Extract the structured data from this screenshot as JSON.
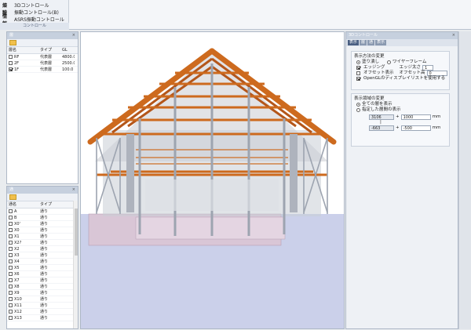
{
  "ribbon": {
    "rows": [
      {
        "icon": "燦",
        "label": "3Dコントロール"
      },
      {
        "icon": "驗",
        "label": "振動コントロール(B)"
      },
      {
        "icon": "情報",
        "label": "ASRS振動コントロール"
      }
    ],
    "group_label": "コントロール"
  },
  "layer_panel": {
    "title": "層",
    "columns": [
      "層名",
      "タイプ",
      "GL"
    ],
    "rows": [
      {
        "name": "RF",
        "type": "代表層",
        "gl": "4800.0",
        "checked": false
      },
      {
        "name": "2F",
        "type": "代表層",
        "gl": "2500.0",
        "checked": false
      },
      {
        "name": "1F",
        "type": "代表層",
        "gl": "100.0",
        "checked": true
      }
    ]
  },
  "grid_panel": {
    "title": "通",
    "columns": [
      "通名",
      "タイプ"
    ],
    "rows": [
      {
        "name": "A",
        "type": "通り"
      },
      {
        "name": "B",
        "type": "通り"
      },
      {
        "name": "X0'",
        "type": "通り"
      },
      {
        "name": "X0",
        "type": "通り"
      },
      {
        "name": "X1",
        "type": "通り"
      },
      {
        "name": "X2?",
        "type": "通り"
      },
      {
        "name": "X2",
        "type": "通り"
      },
      {
        "name": "X3",
        "type": "通り"
      },
      {
        "name": "X4",
        "type": "通り"
      },
      {
        "name": "X5",
        "type": "通り"
      },
      {
        "name": "X6",
        "type": "通り"
      },
      {
        "name": "X7",
        "type": "通り"
      },
      {
        "name": "X8",
        "type": "通り"
      },
      {
        "name": "X9",
        "type": "通り"
      },
      {
        "name": "X10",
        "type": "通り"
      },
      {
        "name": "X11",
        "type": "通り"
      },
      {
        "name": "X12",
        "type": "通り"
      },
      {
        "name": "X13",
        "type": "通り"
      }
    ]
  },
  "control_panel": {
    "title": "3Dコントロール",
    "tabs": [
      "表示",
      "層",
      "通",
      "表示"
    ],
    "display_method": {
      "title": "表示方法の変更",
      "radio1": "塗り潰し",
      "radio2": "ワイヤーフレーム",
      "edging": "エッジング",
      "edge_label": "エッジ太さ",
      "edge_value": "1",
      "offset": "オフセット表示",
      "offset_label": "オフセット高",
      "offset_value": "0",
      "opengl": "OpenGLのディスプレイリストを使用する"
    },
    "display_range": {
      "title": "表示領域の変更",
      "all": "全ての層を表示",
      "specified": "指定した層間の表示",
      "upper_select": "3106",
      "upper_value": "1000",
      "lower_select": "-663",
      "lower_value": "-500",
      "unit": "mm",
      "plus": "+",
      "sep": "|"
    }
  },
  "colors": {
    "timber": "#cd6a1e",
    "steel": "#b9bec8",
    "floor": "#d9c6d6",
    "ground": "#cbd0ea"
  }
}
